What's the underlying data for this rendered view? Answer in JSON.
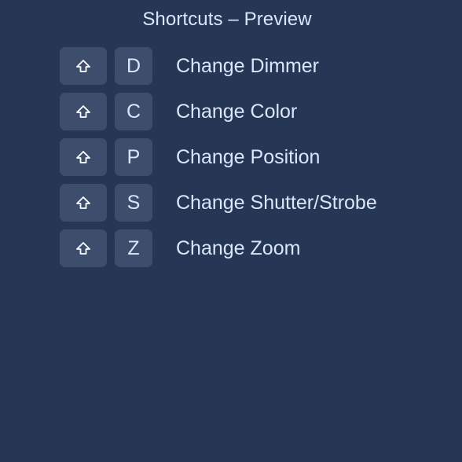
{
  "title": "Shortcuts – Preview",
  "modifier_icon": "shift-icon",
  "shortcuts": [
    {
      "modifier": "shift",
      "key": "D",
      "action": "Change Dimmer"
    },
    {
      "modifier": "shift",
      "key": "C",
      "action": "Change Color"
    },
    {
      "modifier": "shift",
      "key": "P",
      "action": "Change Position"
    },
    {
      "modifier": "shift",
      "key": "S",
      "action": "Change Shutter/Strobe"
    },
    {
      "modifier": "shift",
      "key": "Z",
      "action": "Change Zoom"
    }
  ],
  "colors": {
    "background": "#263655",
    "key_background": "#3d4d6c",
    "text": "#dbe6fb"
  }
}
